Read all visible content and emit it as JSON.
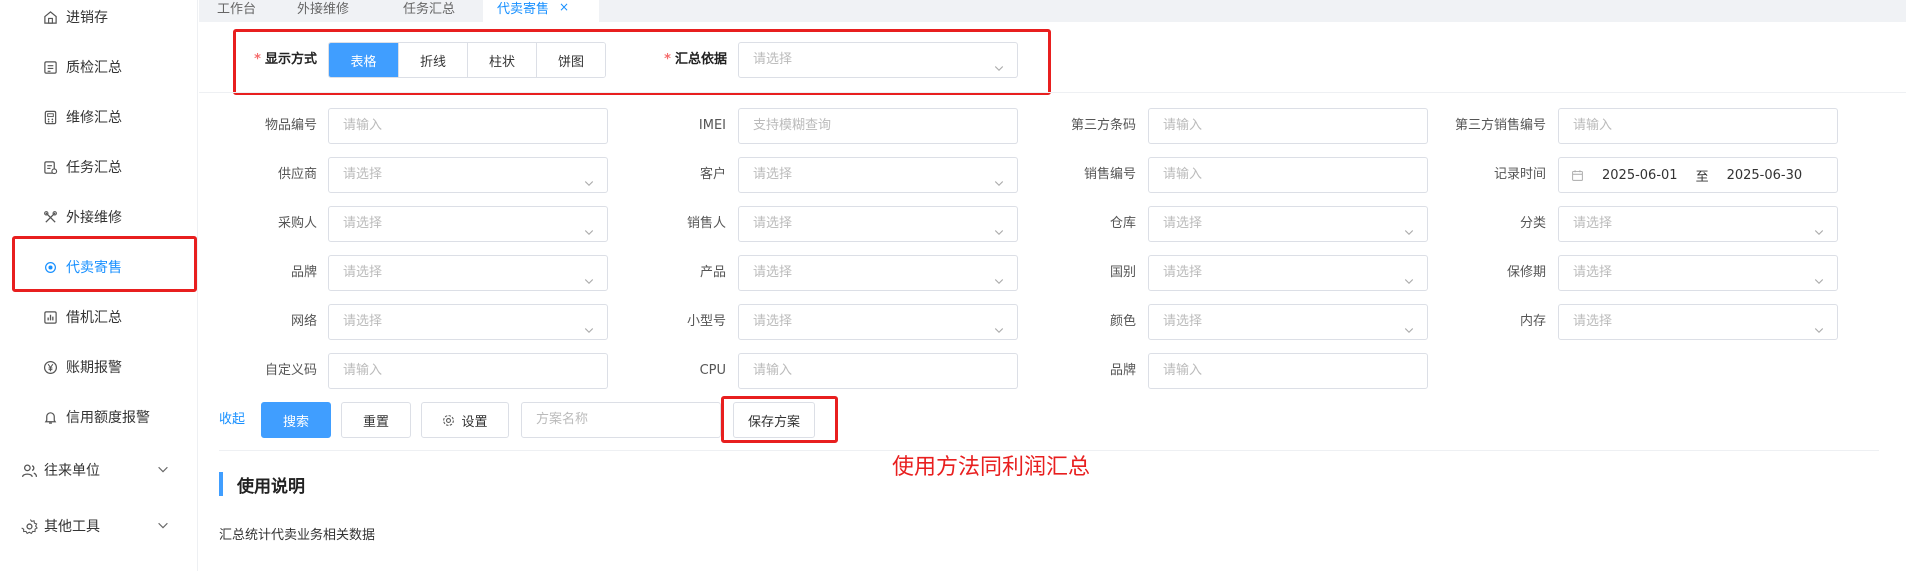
{
  "sidebar": {
    "items": [
      {
        "label": "进销存",
        "icon": "house-icon"
      },
      {
        "label": "质检汇总",
        "icon": "report-icon"
      },
      {
        "label": "维修汇总",
        "icon": "calculator-icon"
      },
      {
        "label": "任务汇总",
        "icon": "task-icon"
      },
      {
        "label": "外接维修",
        "icon": "tools-icon"
      },
      {
        "label": "代卖寄售",
        "icon": "circle-dot-icon",
        "active": true
      },
      {
        "label": "借机汇总",
        "icon": "bar-chart-icon"
      },
      {
        "label": "账期报警",
        "icon": "yen-icon"
      },
      {
        "label": "信用额度报警",
        "icon": "bell-icon"
      }
    ],
    "groups": [
      {
        "label": "往来单位",
        "icon": "people-icon"
      },
      {
        "label": "其他工具",
        "icon": "gear-icon"
      }
    ]
  },
  "tabs": [
    {
      "label": "工作台"
    },
    {
      "label": "外接维修"
    },
    {
      "label": "任务汇总"
    },
    {
      "label": "代卖寄售",
      "active": true,
      "close": "×"
    }
  ],
  "display": {
    "label": "显示方式",
    "options": [
      "表格",
      "折线",
      "柱状",
      "饼图"
    ],
    "selected": "表格"
  },
  "summary_basis": {
    "label": "汇总依据",
    "placeholder": "请选择"
  },
  "filters": {
    "row1": [
      {
        "label": "物品编号",
        "placeholder": "请输入"
      },
      {
        "label": "IMEI",
        "placeholder": "支持模糊查询"
      },
      {
        "label": "第三方条码",
        "placeholder": "请输入"
      },
      {
        "label": "第三方销售编号",
        "placeholder": "请输入"
      }
    ],
    "row2": [
      {
        "label": "供应商",
        "placeholder": "请选择"
      },
      {
        "label": "客户",
        "placeholder": "请选择"
      },
      {
        "label": "销售编号",
        "placeholder": "请输入"
      },
      {
        "label": "记录时间",
        "start": "2025-06-01",
        "sep": "至",
        "end": "2025-06-30"
      }
    ],
    "row3": [
      {
        "label": "采购人",
        "placeholder": "请选择"
      },
      {
        "label": "销售人",
        "placeholder": "请选择"
      },
      {
        "label": "仓库",
        "placeholder": "请选择"
      },
      {
        "label": "分类",
        "placeholder": "请选择"
      }
    ],
    "row4": [
      {
        "label": "品牌",
        "placeholder": "请选择"
      },
      {
        "label": "产品",
        "placeholder": "请选择"
      },
      {
        "label": "国别",
        "placeholder": "请选择"
      },
      {
        "label": "保修期",
        "placeholder": "请选择"
      }
    ],
    "row5": [
      {
        "label": "网络",
        "placeholder": "请选择"
      },
      {
        "label": "小型号",
        "placeholder": "请选择"
      },
      {
        "label": "颜色",
        "placeholder": "请选择"
      },
      {
        "label": "内存",
        "placeholder": "请选择"
      }
    ],
    "row6": [
      {
        "label": "自定义码",
        "placeholder": "请输入"
      },
      {
        "label": "CPU",
        "placeholder": "请输入"
      },
      {
        "label": "品牌",
        "placeholder": "请输入"
      }
    ]
  },
  "actions": {
    "collapse": "收起",
    "search": "搜索",
    "reset": "重置",
    "settings": "设置",
    "scheme_placeholder": "方案名称",
    "save_scheme": "保存方案"
  },
  "annotation": "使用方法同利润汇总",
  "usage": {
    "title": "使用说明",
    "description": "汇总统计代卖业务相关数据"
  },
  "colors": {
    "accent": "#409eff",
    "annotation": "#e81f1f"
  }
}
